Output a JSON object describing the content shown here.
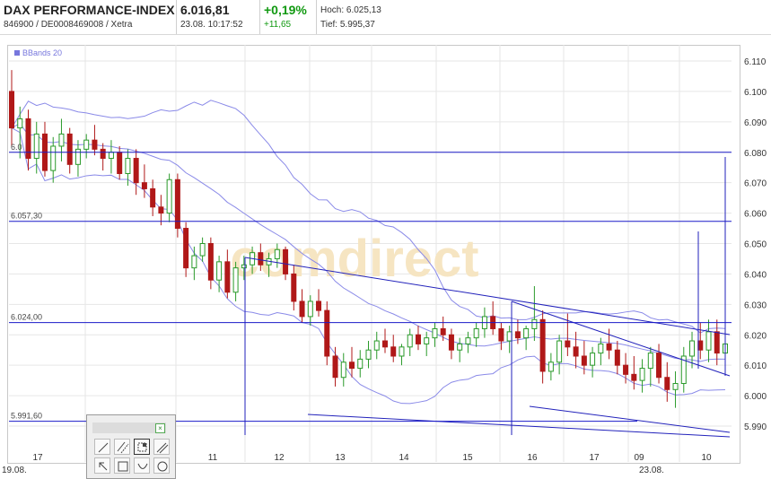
{
  "header": {
    "name": "DAX PERFORMANCE-INDEX",
    "ids": "846900 / DE0008469008 / Xetra",
    "price": "6.016,81",
    "time": "23.08. 10:17:52",
    "change_pct": "+0,19%",
    "change_abs": "+11,65",
    "high": "Hoch: 6.025,13",
    "low": "Tief: 5.995,37"
  },
  "legend": {
    "label": "BBands 20"
  },
  "watermark": "comdirect",
  "level_labels": {
    "l6080": "6.0",
    "l6057": "6.057,30",
    "l6024": "6.024,00",
    "l5991": "5.991,60"
  },
  "chart_data": {
    "type": "candlestick",
    "y_ticks": [
      "6.110",
      "6.100",
      "6.090",
      "6.080",
      "6.070",
      "6.060",
      "6.050",
      "6.040",
      "6.030",
      "6.020",
      "6.010",
      "6.000",
      "5.990"
    ],
    "ylim": [
      5990,
      6110
    ],
    "x_ticks": [
      "17",
      "10",
      "11",
      "12",
      "13",
      "14",
      "15",
      "16",
      "17",
      "09",
      "10"
    ],
    "x_date_labels": [
      "19.08.",
      "23.08."
    ],
    "horizontal_levels": [
      6080,
      6057.3,
      6024.0,
      5991.6
    ],
    "indicator": "BBands 20",
    "ohlc": [
      [
        6100,
        6107,
        6082,
        6088
      ],
      [
        6088,
        6095,
        6078,
        6091
      ],
      [
        6091,
        6094,
        6074,
        6078
      ],
      [
        6078,
        6090,
        6073,
        6086
      ],
      [
        6086,
        6090,
        6072,
        6074
      ],
      [
        6074,
        6085,
        6070,
        6082
      ],
      [
        6082,
        6091,
        6077,
        6086
      ],
      [
        6086,
        6088,
        6073,
        6076
      ],
      [
        6076,
        6084,
        6072,
        6081
      ],
      [
        6081,
        6086,
        6078,
        6084
      ],
      [
        6084,
        6089,
        6079,
        6081
      ],
      [
        6081,
        6083,
        6074,
        6078
      ],
      [
        6078,
        6084,
        6073,
        6080
      ],
      [
        6080,
        6082,
        6071,
        6073
      ],
      [
        6073,
        6081,
        6069,
        6078
      ],
      [
        6078,
        6081,
        6066,
        6070
      ],
      [
        6070,
        6076,
        6065,
        6068
      ],
      [
        6068,
        6071,
        6059,
        6062
      ],
      [
        6062,
        6066,
        6056,
        6060
      ],
      [
        6060,
        6073,
        6057,
        6071
      ],
      [
        6071,
        6073,
        6052,
        6055
      ],
      [
        6055,
        6057,
        6039,
        6042
      ],
      [
        6042,
        6049,
        6038,
        6046
      ],
      [
        6046,
        6052,
        6044,
        6050
      ],
      [
        6050,
        6052,
        6035,
        6038
      ],
      [
        6038,
        6046,
        6034,
        6044
      ],
      [
        6044,
        6048,
        6032,
        6034
      ],
      [
        6034,
        6044,
        6031,
        6042
      ],
      [
        6042,
        6046,
        6038,
        6043
      ],
      [
        6043,
        6049,
        6040,
        6047
      ],
      [
        6047,
        6050,
        6041,
        6043
      ],
      [
        6043,
        6047,
        6039,
        6045
      ],
      [
        6045,
        6050,
        6042,
        6048
      ],
      [
        6048,
        6049,
        6038,
        6040
      ],
      [
        6040,
        6043,
        6028,
        6031
      ],
      [
        6031,
        6035,
        6024,
        6026
      ],
      [
        6026,
        6033,
        6023,
        6031
      ],
      [
        6031,
        6035,
        6026,
        6028
      ],
      [
        6028,
        6031,
        6010,
        6013
      ],
      [
        6013,
        6016,
        6003,
        6006
      ],
      [
        6006,
        6014,
        6003,
        6011
      ],
      [
        6011,
        6016,
        6006,
        6009
      ],
      [
        6009,
        6015,
        6006,
        6012
      ],
      [
        6012,
        6018,
        6009,
        6015
      ],
      [
        6015,
        6021,
        6012,
        6018
      ],
      [
        6018,
        6022,
        6014,
        6016
      ],
      [
        6016,
        6020,
        6011,
        6013
      ],
      [
        6013,
        6017,
        6010,
        6016
      ],
      [
        6016,
        6022,
        6013,
        6020
      ],
      [
        6020,
        6023,
        6015,
        6017
      ],
      [
        6017,
        6021,
        6013,
        6019
      ],
      [
        6019,
        6024,
        6016,
        6022
      ],
      [
        6022,
        6026,
        6018,
        6020
      ],
      [
        6020,
        6022,
        6012,
        6015
      ],
      [
        6015,
        6019,
        6011,
        6017
      ],
      [
        6017,
        6021,
        6014,
        6019
      ],
      [
        6019,
        6024,
        6016,
        6022
      ],
      [
        6022,
        6029,
        6019,
        6026
      ],
      [
        6026,
        6031,
        6020,
        6022
      ],
      [
        6022,
        6024,
        6015,
        6018
      ],
      [
        6018,
        6023,
        6014,
        6021
      ],
      [
        6021,
        6025,
        6017,
        6019
      ],
      [
        6019,
        6023,
        6015,
        6022
      ],
      [
        6022,
        6036,
        6018,
        6025
      ],
      [
        6025,
        6028,
        6004,
        6008
      ],
      [
        6008,
        6014,
        6005,
        6011
      ],
      [
        6011,
        6020,
        6007,
        6018
      ],
      [
        6018,
        6027,
        6013,
        6016
      ],
      [
        6016,
        6021,
        6009,
        6013
      ],
      [
        6013,
        6018,
        6007,
        6010
      ],
      [
        6010,
        6016,
        6006,
        6014
      ],
      [
        6014,
        6019,
        6010,
        6017
      ],
      [
        6017,
        6022,
        6012,
        6015
      ],
      [
        6015,
        6018,
        6007,
        6010
      ],
      [
        6010,
        6014,
        6004,
        6007
      ],
      [
        6007,
        6013,
        6002,
        6005
      ],
      [
        6005,
        6012,
        6001,
        6009
      ],
      [
        6009,
        6016,
        6003,
        6014
      ],
      [
        6014,
        6017,
        6004,
        6006
      ],
      [
        6006,
        6011,
        5998,
        6002
      ],
      [
        6002,
        6008,
        5996,
        6004
      ],
      [
        6004,
        6016,
        6001,
        6013
      ],
      [
        6013,
        6021,
        6009,
        6018
      ],
      [
        6018,
        6024,
        6012,
        6015
      ],
      [
        6015,
        6025,
        6011,
        6021
      ],
      [
        6021,
        6025,
        6010,
        6014
      ],
      [
        6014,
        6020,
        6010,
        6017
      ]
    ]
  },
  "tools": [
    "line-tool",
    "parallel-tool",
    "fib-tool",
    "channel-tool",
    "arrow-tool",
    "rect-tool",
    "arc-tool",
    "circle-tool"
  ]
}
